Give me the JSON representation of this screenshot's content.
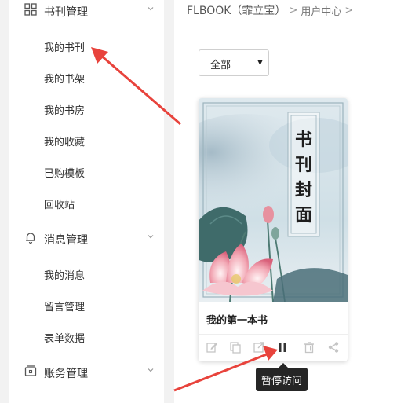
{
  "sidebar": {
    "groups": [
      {
        "label": "书刊管理",
        "icon": "grid-icon",
        "items": [
          "我的书刊",
          "我的书架",
          "我的书房",
          "我的收藏",
          "已购模板",
          "回收站"
        ]
      },
      {
        "label": "消息管理",
        "icon": "bell-icon",
        "items": [
          "我的消息",
          "留言管理",
          "表单数据"
        ]
      },
      {
        "label": "账务管理",
        "icon": "wallet-icon",
        "items": []
      }
    ]
  },
  "breadcrumb": {
    "main": "FLBOOK（霏立宝）",
    "sep1": ">",
    "link": "用户中心",
    "sep2": ">"
  },
  "filter": {
    "selected": "全部",
    "arrow": "▼"
  },
  "book": {
    "title": "我的第一本书",
    "cover_text": [
      "书",
      "刊",
      "封",
      "面"
    ]
  },
  "actions": [
    "edit-icon",
    "copy-icon",
    "share-out-icon",
    "pause-icon",
    "trash-icon",
    "share-icon"
  ],
  "tooltip": {
    "text": "暂停访问"
  },
  "colors": {
    "arrow_red": "#e8433c",
    "tooltip_bg": "#262626",
    "sidebar_bg": "#ffffff",
    "page_bg": "#f2f2f2"
  }
}
